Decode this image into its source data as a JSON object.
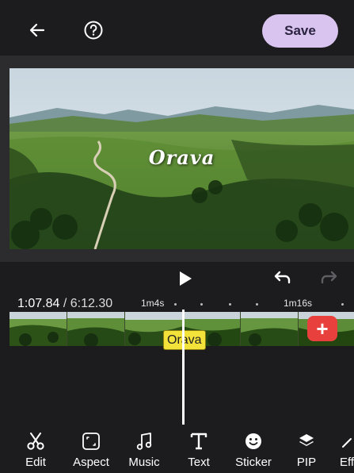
{
  "header": {
    "back_icon": "arrow-left-icon",
    "help_icon": "question-circle-icon",
    "save_label": "Save",
    "save_color": "#d9c4ef"
  },
  "preview": {
    "overlay_title": "Orava"
  },
  "playback": {
    "play_icon": "play-icon",
    "undo_icon": "undo-icon",
    "redo_icon": "redo-icon",
    "current_time": "1:07.84",
    "separator": " / ",
    "total_time": "6:12.30",
    "ruler_labels": [
      "1m4s",
      "1m16s"
    ]
  },
  "timeline": {
    "add_label": "+",
    "add_color": "#e8403c",
    "text_clip_label": "Orava",
    "text_clip_color": "#f2e23a"
  },
  "toolbar": {
    "items": [
      {
        "label": "Edit",
        "icon": "scissors-icon"
      },
      {
        "label": "Aspect",
        "icon": "aspect-ratio-icon"
      },
      {
        "label": "Music",
        "icon": "music-note-icon"
      },
      {
        "label": "Text",
        "icon": "text-icon"
      },
      {
        "label": "Sticker",
        "icon": "smiley-icon"
      },
      {
        "label": "PIP",
        "icon": "layers-icon"
      },
      {
        "label": "Eff",
        "icon": "effects-icon"
      }
    ]
  }
}
